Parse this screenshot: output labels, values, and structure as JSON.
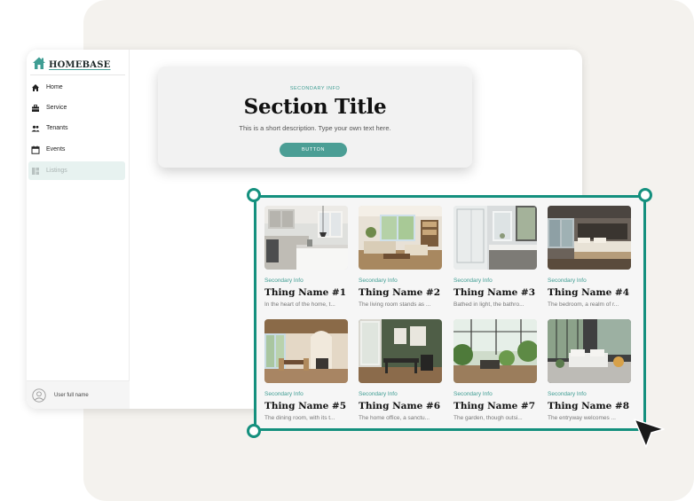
{
  "brand": {
    "name": "HOMEBASE",
    "accent": "#14907e",
    "accent_soft": "#4b9e95"
  },
  "sidebar": {
    "items": [
      {
        "label": "Home",
        "icon": "home-icon"
      },
      {
        "label": "Service",
        "icon": "toolbox-icon"
      },
      {
        "label": "Tenants",
        "icon": "people-icon"
      },
      {
        "label": "Events",
        "icon": "calendar-icon"
      },
      {
        "label": "Listings",
        "icon": "dashboard-icon",
        "active": true
      }
    ],
    "user": {
      "name": "User full name",
      "icon": "user-avatar-icon"
    }
  },
  "hero": {
    "secondary": "SECONDARY INFO",
    "title": "Section Title",
    "description": "This is a short description. Type your own text here.",
    "button_label": "BUTTON"
  },
  "listings": [
    {
      "secondary": "Secondary Info",
      "name": "Thing Name #1",
      "description": "In the heart of the home, t...",
      "image": "kitchen"
    },
    {
      "secondary": "Secondary Info",
      "name": "Thing Name #2",
      "description": "The living room stands as ...",
      "image": "living room"
    },
    {
      "secondary": "Secondary Info",
      "name": "Thing Name #3",
      "description": "Bathed in light, the bathro...",
      "image": "bathroom"
    },
    {
      "secondary": "Secondary Info",
      "name": "Thing Name #4",
      "description": "The bedroom, a realm of r...",
      "image": "bedroom"
    },
    {
      "secondary": "Secondary Info",
      "name": "Thing Name #5",
      "description": "The dining room, with its t...",
      "image": "dining room"
    },
    {
      "secondary": "Secondary Info",
      "name": "Thing Name #6",
      "description": "The home office, a sanctu...",
      "image": "home office"
    },
    {
      "secondary": "Secondary Info",
      "name": "Thing Name #7",
      "description": "The garden, though outsi...",
      "image": "garden"
    },
    {
      "secondary": "Secondary Info",
      "name": "Thing Name #8",
      "description": "The entryway welcomes ...",
      "image": "entryway"
    }
  ]
}
